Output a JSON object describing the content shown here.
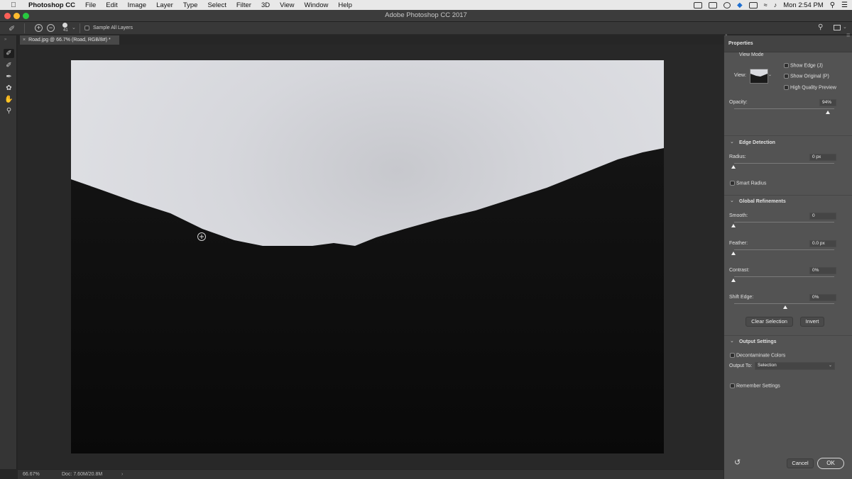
{
  "menubar": {
    "app_name": "Photoshop CC",
    "items": [
      "File",
      "Edit",
      "Image",
      "Layer",
      "Type",
      "Select",
      "Filter",
      "3D",
      "View",
      "Window",
      "Help"
    ],
    "clock": "Mon 2:54 PM"
  },
  "window": {
    "title": "Adobe Photoshop CC 2017"
  },
  "options": {
    "brush_size": "41",
    "sample_all_layers": "Sample All Layers"
  },
  "document": {
    "tab_title": "Road.jpg @ 66.7% (Road, RGB/8#) *"
  },
  "status": {
    "zoom": "66.67%",
    "doc_size": "Doc: 7.60M/20.8M"
  },
  "properties": {
    "title": "Properties",
    "view_mode": {
      "label": "View Mode",
      "view_label": "View:",
      "show_edge": "Show Edge (J)",
      "show_original": "Show Original (P)",
      "high_quality": "High Quality Preview"
    },
    "opacity": {
      "label": "Opacity:",
      "value": "94%",
      "level_percent": 94
    },
    "edge_detection": {
      "header": "Edge Detection",
      "radius_label": "Radius:",
      "radius_value": "0 px",
      "smart_radius": "Smart Radius"
    },
    "global_refinements": {
      "header": "Global Refinements",
      "smooth_label": "Smooth:",
      "smooth_value": "0",
      "feather_label": "Feather:",
      "feather_value": "0.0 px",
      "contrast_label": "Contrast:",
      "contrast_value": "0%",
      "shift_edge_label": "Shift Edge:",
      "shift_edge_value": "0%"
    },
    "buttons": {
      "clear_selection": "Clear Selection",
      "invert": "Invert",
      "cancel": "Cancel",
      "ok": "OK"
    },
    "output_settings": {
      "header": "Output Settings",
      "decontaminate": "Decontaminate Colors",
      "output_to_label": "Output To:",
      "output_to_value": "Selection"
    },
    "remember_settings": "Remember Settings"
  },
  "colors": {
    "panel": "#535353",
    "canvas_bg": "#282828",
    "sky": "#d8d9de",
    "ground": "#0e0e0e"
  }
}
